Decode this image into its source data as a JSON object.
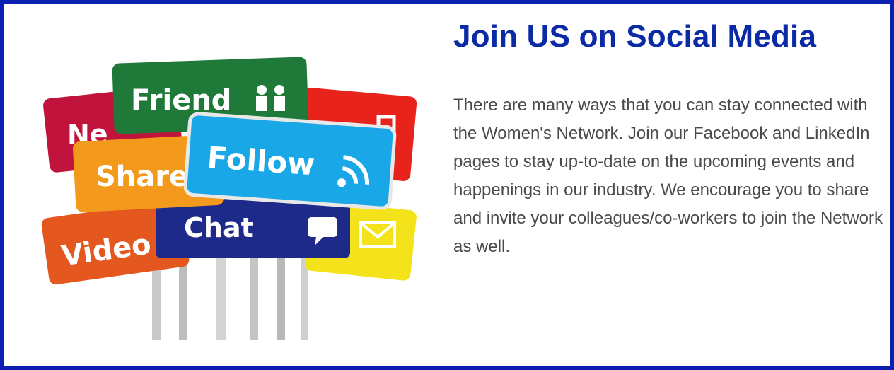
{
  "signs": {
    "friend": "Friend",
    "news": "Ne",
    "share": "Share",
    "follow": "Follow",
    "video": "Video",
    "chat": "Chat"
  },
  "heading": "Join US on Social Media",
  "paragraph": "There are many ways that you can stay connected with the Women's Network. Join our Facebook and LinkedIn pages to stay up-to-date on the upcoming events and happenings in our industry. We encourage you to share and invite your colleagues/co-workers to join the Network as well.",
  "colors": {
    "border": "#0b1fb3",
    "heading": "#0b2aa6",
    "body_text": "#4a4a4a"
  }
}
